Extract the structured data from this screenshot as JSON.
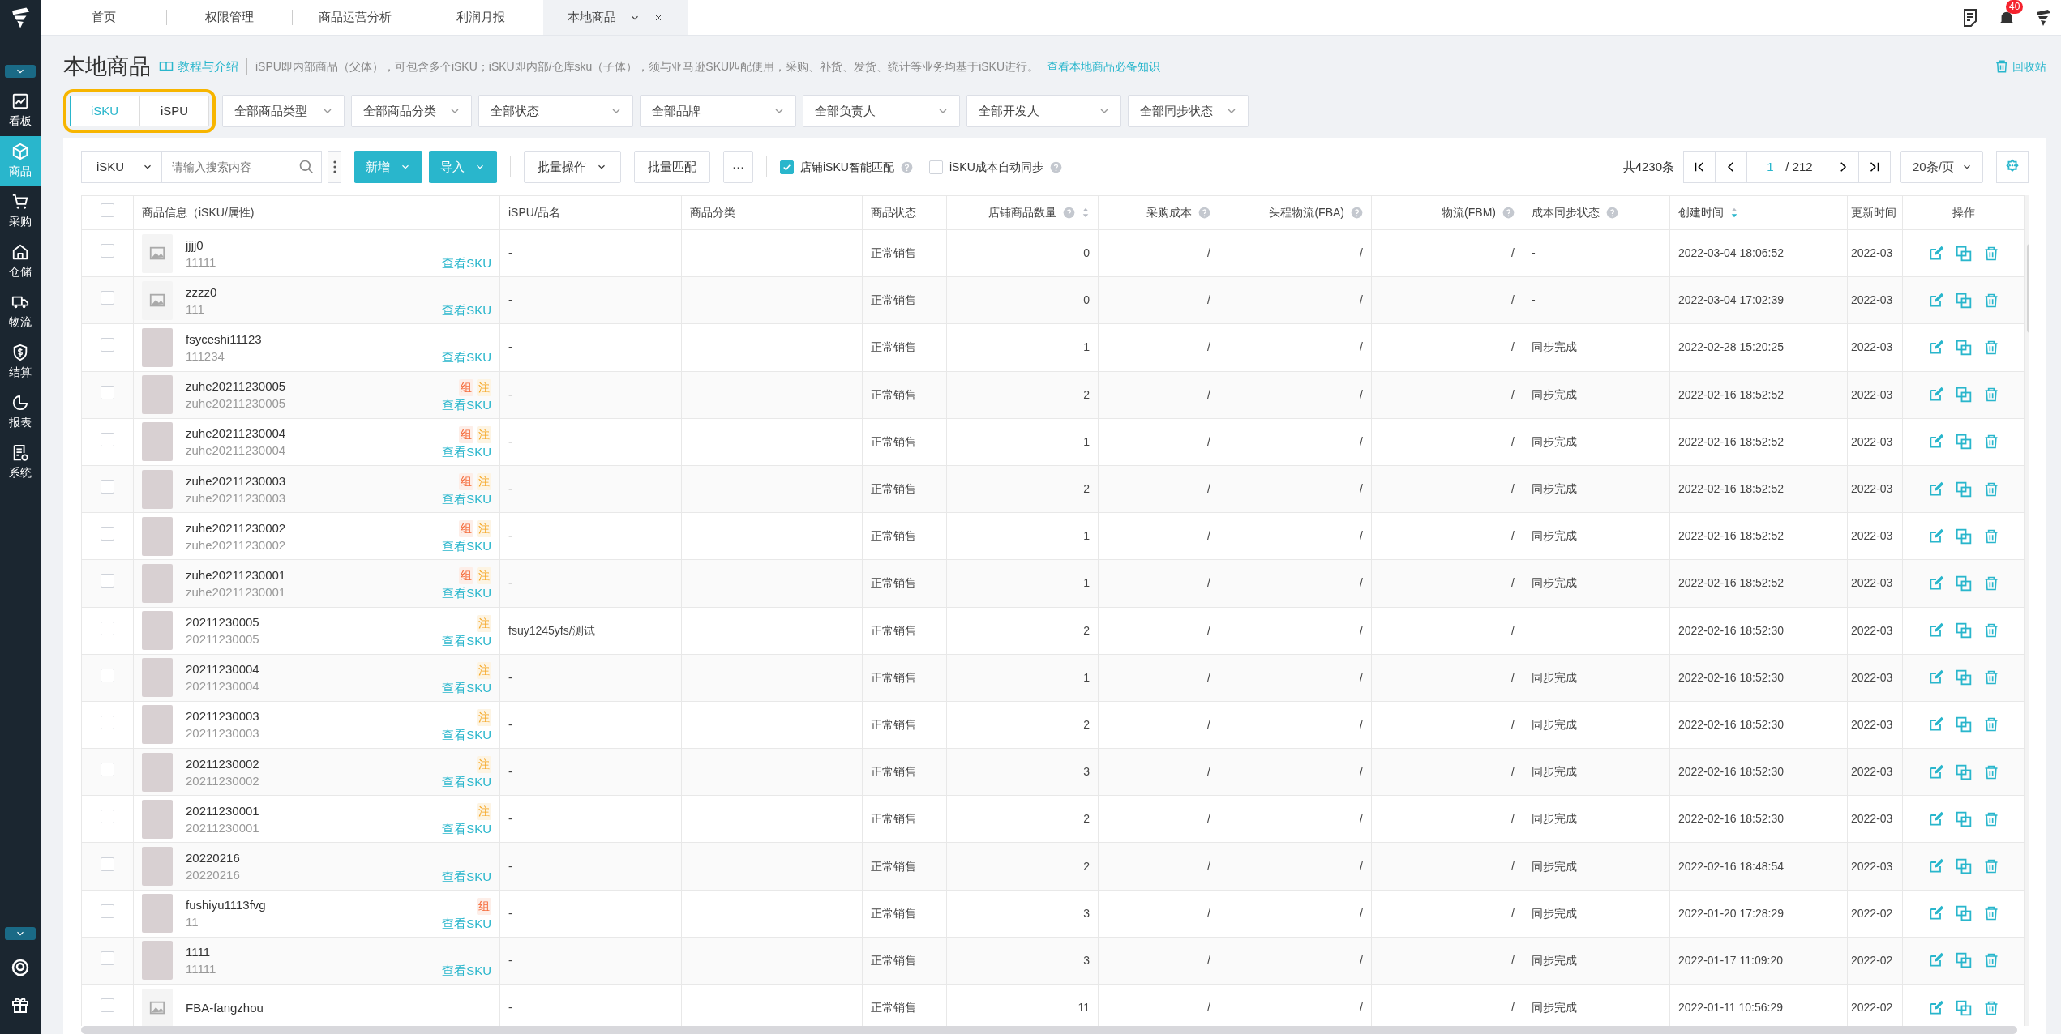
{
  "sidebar": {
    "items": [
      {
        "label": "看板",
        "selected": false
      },
      {
        "label": "商品",
        "selected": true
      },
      {
        "label": "采购",
        "selected": false
      },
      {
        "label": "仓储",
        "selected": false
      },
      {
        "label": "物流",
        "selected": false
      },
      {
        "label": "结算",
        "selected": false
      },
      {
        "label": "报表",
        "selected": false
      },
      {
        "label": "系统",
        "selected": false
      }
    ]
  },
  "tabs": [
    {
      "label": "首页",
      "selected": false,
      "closable": false
    },
    {
      "label": "权限管理",
      "selected": false,
      "closable": false
    },
    {
      "label": "商品运营分析",
      "selected": false,
      "closable": false
    },
    {
      "label": "利润月报",
      "selected": false,
      "closable": false
    },
    {
      "label": "本地商品",
      "selected": true,
      "closable": true
    }
  ],
  "header": {
    "notification_count": "40"
  },
  "page": {
    "title": "本地商品",
    "help_link": "教程与介绍",
    "description": "iSPU即内部商品（父体），可包含多个iSKU；iSKU即内部/仓库sku（子体），须与亚马逊SKU匹配使用，采购、补货、发货、统计等业务均基于iSKU进行。",
    "knowledge_link": "查看本地商品必备知识",
    "recycle_bin": "回收站"
  },
  "view_toggle": {
    "highlighted": true,
    "options": [
      {
        "label": "iSKU",
        "selected": true
      },
      {
        "label": "iSPU",
        "selected": false
      }
    ]
  },
  "filters": [
    "全部商品类型",
    "全部商品分类",
    "全部状态",
    "全部品牌",
    "全部负责人",
    "全部开发人",
    "全部同步状态"
  ],
  "toolbar": {
    "search_type": "iSKU",
    "search_placeholder": "请输入搜索内容",
    "add_button": "新增",
    "import_button": "导入",
    "batch_ops": "批量操作",
    "batch_match": "批量匹配",
    "more": "···",
    "options": [
      {
        "label": "店铺iSKU智能匹配",
        "checked": true,
        "help": true
      },
      {
        "label": "iSKU成本自动同步",
        "checked": false,
        "help": true
      }
    ]
  },
  "pagination": {
    "total": "共4230条",
    "page": "1",
    "pages": "/ 212",
    "page_size": "20条/页"
  },
  "table": {
    "select_all_checked": false,
    "columns": [
      {
        "kind": "check"
      },
      {
        "kind": "product",
        "label": "商品信息（iSKU/属性)"
      },
      {
        "kind": "text",
        "label": "iSPU/品名"
      },
      {
        "kind": "text",
        "label": "商品分类"
      },
      {
        "kind": "text",
        "label": "商品状态"
      },
      {
        "kind": "number",
        "label": "店铺商品数量",
        "help": true,
        "sortable": true,
        "sorted": false
      },
      {
        "kind": "number",
        "label": "采购成本",
        "help": true
      },
      {
        "kind": "number",
        "label": "头程物流(FBA)",
        "help": true
      },
      {
        "kind": "number",
        "label": "物流(FBM)",
        "help": true
      },
      {
        "kind": "text",
        "label": "成本同步状态",
        "help": true
      },
      {
        "kind": "text",
        "label": "创建时间",
        "sortable": true,
        "sorted": true
      },
      {
        "kind": "text",
        "label": "更新时间"
      },
      {
        "kind": "actions",
        "label": "操作"
      }
    ],
    "rows": [
      {
        "kind": "no-image",
        "checked": false,
        "name": "jjjj0",
        "attr": "11111",
        "tags": [],
        "link": "查看SKU",
        "ispu": "-",
        "status": "正常销售",
        "qty": "0",
        "cost": "/",
        "fba": "/",
        "fbm": "/",
        "sync": "-",
        "created": "2022-03-04 18:06:52",
        "updated": "2022-03"
      },
      {
        "kind": "no-image",
        "checked": false,
        "name": "zzzz0",
        "attr": "111",
        "tags": [],
        "link": "查看SKU",
        "ispu": "-",
        "status": "正常销售",
        "qty": "0",
        "cost": "/",
        "fba": "/",
        "fbm": "/",
        "sync": "-",
        "created": "2022-03-04 17:02:39",
        "updated": "2022-03"
      },
      {
        "kind": "photo",
        "checked": false,
        "name": "fsyceshi11123",
        "attr": "111234",
        "tags": [],
        "link": "查看SKU",
        "ispu": "-",
        "status": "正常销售",
        "qty": "1",
        "cost": "/",
        "fba": "/",
        "fbm": "/",
        "sync": "同步完成",
        "created": "2022-02-28 15:20:25",
        "updated": "2022-03"
      },
      {
        "kind": "photo",
        "checked": false,
        "name": "zuhe20211230005",
        "attr": "zuhe20211230005",
        "tags": [
          {
            "kind": "bundle",
            "label": "组"
          },
          {
            "kind": "note",
            "label": "注"
          }
        ],
        "link": "查看SKU",
        "ispu": "-",
        "status": "正常销售",
        "qty": "2",
        "cost": "/",
        "fba": "/",
        "fbm": "/",
        "sync": "同步完成",
        "created": "2022-02-16 18:52:52",
        "updated": "2022-03"
      },
      {
        "kind": "photo",
        "checked": false,
        "name": "zuhe20211230004",
        "attr": "zuhe20211230004",
        "tags": [
          {
            "kind": "bundle",
            "label": "组"
          },
          {
            "kind": "note",
            "label": "注"
          }
        ],
        "link": "查看SKU",
        "ispu": "-",
        "status": "正常销售",
        "qty": "1",
        "cost": "/",
        "fba": "/",
        "fbm": "/",
        "sync": "同步完成",
        "created": "2022-02-16 18:52:52",
        "updated": "2022-03"
      },
      {
        "kind": "photo",
        "checked": false,
        "name": "zuhe20211230003",
        "attr": "zuhe20211230003",
        "tags": [
          {
            "kind": "bundle",
            "label": "组"
          },
          {
            "kind": "note",
            "label": "注"
          }
        ],
        "link": "查看SKU",
        "ispu": "-",
        "status": "正常销售",
        "qty": "2",
        "cost": "/",
        "fba": "/",
        "fbm": "/",
        "sync": "同步完成",
        "created": "2022-02-16 18:52:52",
        "updated": "2022-03"
      },
      {
        "kind": "photo",
        "checked": false,
        "name": "zuhe20211230002",
        "attr": "zuhe20211230002",
        "tags": [
          {
            "kind": "bundle",
            "label": "组"
          },
          {
            "kind": "note",
            "label": "注"
          }
        ],
        "link": "查看SKU",
        "ispu": "-",
        "status": "正常销售",
        "qty": "1",
        "cost": "/",
        "fba": "/",
        "fbm": "/",
        "sync": "同步完成",
        "created": "2022-02-16 18:52:52",
        "updated": "2022-03"
      },
      {
        "kind": "photo",
        "checked": false,
        "name": "zuhe20211230001",
        "attr": "zuhe20211230001",
        "tags": [
          {
            "kind": "bundle",
            "label": "组"
          },
          {
            "kind": "note",
            "label": "注"
          }
        ],
        "link": "查看SKU",
        "ispu": "-",
        "status": "正常销售",
        "qty": "1",
        "cost": "/",
        "fba": "/",
        "fbm": "/",
        "sync": "同步完成",
        "created": "2022-02-16 18:52:52",
        "updated": "2022-03"
      },
      {
        "kind": "photo",
        "checked": false,
        "name": "20211230005",
        "attr": "20211230005",
        "tags": [
          {
            "kind": "note",
            "label": "注"
          }
        ],
        "link": "查看SKU",
        "ispu": "fsuy1245yfs/测试",
        "status": "正常销售",
        "qty": "2",
        "cost": "/",
        "fba": "/",
        "fbm": "/",
        "created": "2022-02-16 18:52:30",
        "updated": "2022-03"
      },
      {
        "kind": "photo",
        "checked": false,
        "name": "20211230004",
        "attr": "20211230004",
        "tags": [
          {
            "kind": "note",
            "label": "注"
          }
        ],
        "link": "查看SKU",
        "ispu": "-",
        "status": "正常销售",
        "qty": "1",
        "cost": "/",
        "fba": "/",
        "fbm": "/",
        "sync": "同步完成",
        "created": "2022-02-16 18:52:30",
        "updated": "2022-03"
      },
      {
        "kind": "photo",
        "checked": false,
        "name": "20211230003",
        "attr": "20211230003",
        "tags": [
          {
            "kind": "note",
            "label": "注"
          }
        ],
        "link": "查看SKU",
        "ispu": "-",
        "status": "正常销售",
        "qty": "2",
        "cost": "/",
        "fba": "/",
        "fbm": "/",
        "sync": "同步完成",
        "created": "2022-02-16 18:52:30",
        "updated": "2022-03"
      },
      {
        "kind": "photo",
        "checked": false,
        "name": "20211230002",
        "attr": "20211230002",
        "tags": [
          {
            "kind": "note",
            "label": "注"
          }
        ],
        "link": "查看SKU",
        "ispu": "-",
        "status": "正常销售",
        "qty": "3",
        "cost": "/",
        "fba": "/",
        "fbm": "/",
        "sync": "同步完成",
        "created": "2022-02-16 18:52:30",
        "updated": "2022-03"
      },
      {
        "kind": "photo",
        "checked": false,
        "name": "20211230001",
        "attr": "20211230001",
        "tags": [
          {
            "kind": "note",
            "label": "注"
          }
        ],
        "link": "查看SKU",
        "ispu": "-",
        "status": "正常销售",
        "qty": "2",
        "cost": "/",
        "fba": "/",
        "fbm": "/",
        "sync": "同步完成",
        "created": "2022-02-16 18:52:30",
        "updated": "2022-03"
      },
      {
        "kind": "photo",
        "checked": false,
        "name": "20220216",
        "attr": "20220216",
        "tags": [],
        "link": "查看SKU",
        "ispu": "-",
        "status": "正常销售",
        "qty": "2",
        "cost": "/",
        "fba": "/",
        "fbm": "/",
        "sync": "同步完成",
        "created": "2022-02-16 18:48:54",
        "updated": "2022-03"
      },
      {
        "kind": "photo",
        "checked": false,
        "name": "fushiyu1113fvg",
        "attr": "11",
        "tags": [
          {
            "kind": "bundle",
            "label": "组"
          }
        ],
        "link": "查看SKU",
        "ispu": "-",
        "status": "正常销售",
        "qty": "3",
        "cost": "/",
        "fba": "/",
        "fbm": "/",
        "sync": "同步完成",
        "created": "2022-01-20 17:28:29",
        "updated": "2022-02"
      },
      {
        "kind": "photo",
        "checked": false,
        "name": "1111",
        "attr": "11111",
        "tags": [],
        "link": "查看SKU",
        "ispu": "-",
        "status": "正常销售",
        "qty": "3",
        "cost": "/",
        "fba": "/",
        "fbm": "/",
        "sync": "同步完成",
        "created": "2022-01-17 11:09:20",
        "updated": "2022-02"
      },
      {
        "kind": "no-image",
        "checked": false,
        "name": "FBA-fangzhou",
        "tags": [],
        "ispu": "-",
        "status": "正常销售",
        "qty": "11",
        "cost": "/",
        "fba": "/",
        "fbm": "/",
        "sync": "同步完成",
        "created": "2022-01-11 10:56:29",
        "updated": "2022-02"
      }
    ]
  }
}
